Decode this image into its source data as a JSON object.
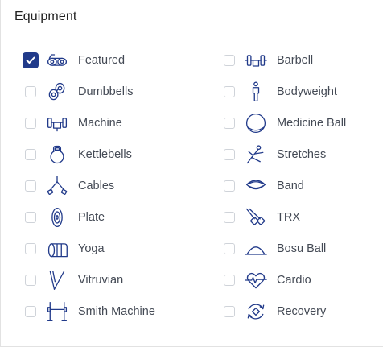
{
  "section": {
    "title": "Equipment"
  },
  "items": [
    {
      "label": "Featured",
      "icon": "featured-rollers-icon",
      "checked": true
    },
    {
      "label": "Barbell",
      "icon": "barbell-icon",
      "checked": false
    },
    {
      "label": "Dumbbells",
      "icon": "dumbbells-icon",
      "checked": false
    },
    {
      "label": "Bodyweight",
      "icon": "bodyweight-icon",
      "checked": false
    },
    {
      "label": "Machine",
      "icon": "machine-icon",
      "checked": false
    },
    {
      "label": "Medicine Ball",
      "icon": "medicine-ball-icon",
      "checked": false
    },
    {
      "label": "Kettlebells",
      "icon": "kettlebell-icon",
      "checked": false
    },
    {
      "label": "Stretches",
      "icon": "stretches-icon",
      "checked": false
    },
    {
      "label": "Cables",
      "icon": "cables-icon",
      "checked": false
    },
    {
      "label": "Band",
      "icon": "band-icon",
      "checked": false
    },
    {
      "label": "Plate",
      "icon": "plate-icon",
      "checked": false
    },
    {
      "label": "TRX",
      "icon": "trx-icon",
      "checked": false
    },
    {
      "label": "Yoga",
      "icon": "yoga-mat-icon",
      "checked": false
    },
    {
      "label": "Bosu Ball",
      "icon": "bosu-ball-icon",
      "checked": false
    },
    {
      "label": "Vitruvian",
      "icon": "vitruvian-icon",
      "checked": false
    },
    {
      "label": "Cardio",
      "icon": "cardio-heart-icon",
      "checked": false
    },
    {
      "label": "Smith Machine",
      "icon": "smith-machine-icon",
      "checked": false
    },
    {
      "label": "Recovery",
      "icon": "recovery-icon",
      "checked": false
    }
  ],
  "colors": {
    "accent": "#213a8a",
    "text": "#444a55",
    "checkbox_border": "#cfd3d9"
  }
}
